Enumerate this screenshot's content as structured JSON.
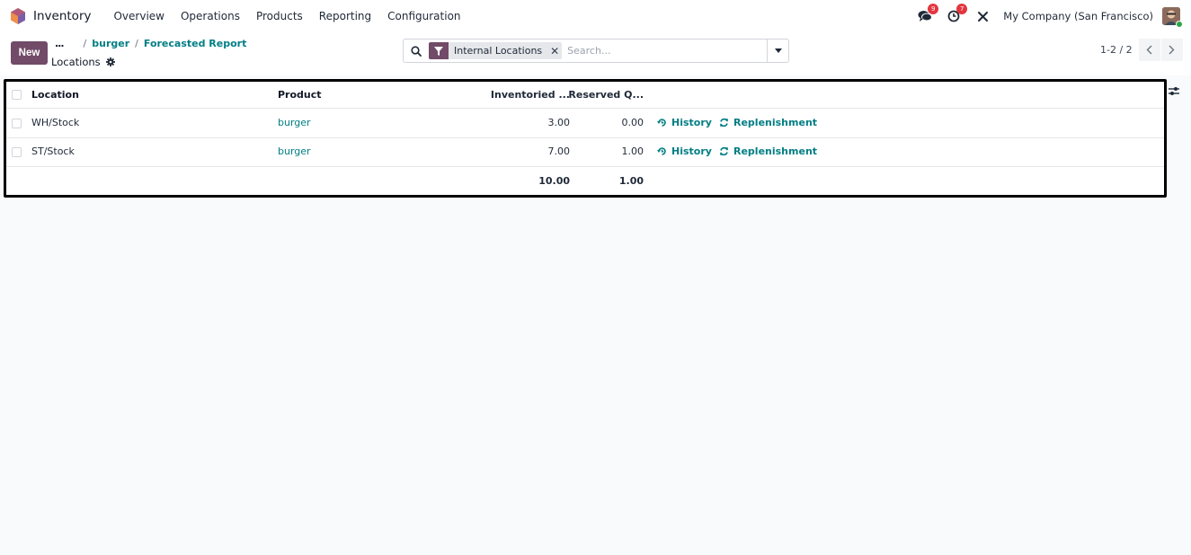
{
  "navbar": {
    "app_name": "Inventory",
    "menu": [
      "Overview",
      "Operations",
      "Products",
      "Reporting",
      "Configuration"
    ],
    "messages_count": "9",
    "activities_count": "7",
    "company": "My Company (San Francisco)"
  },
  "control": {
    "new_label": "New",
    "breadcrumb_more": "...",
    "breadcrumb": [
      "burger",
      "Forecasted Report"
    ],
    "page_title": "Locations",
    "facet_label": "Internal Locations",
    "search_placeholder": "Search...",
    "pager_value": "1-2 / 2"
  },
  "table": {
    "columns": [
      "Location",
      "Product",
      "Inventoried ...",
      "Reserved Q..."
    ],
    "rows": [
      {
        "location": "WH/Stock",
        "product": "burger",
        "inventoried": "3.00",
        "reserved": "0.00",
        "history": "History",
        "replenishment": "Replenishment"
      },
      {
        "location": "ST/Stock",
        "product": "burger",
        "inventoried": "7.00",
        "reserved": "1.00",
        "history": "History",
        "replenishment": "Replenishment"
      }
    ],
    "totals": {
      "inventoried": "10.00",
      "reserved": "1.00"
    }
  },
  "colors": {
    "brand": "#714b67",
    "link": "#017e84",
    "badge": "#e2363f"
  }
}
